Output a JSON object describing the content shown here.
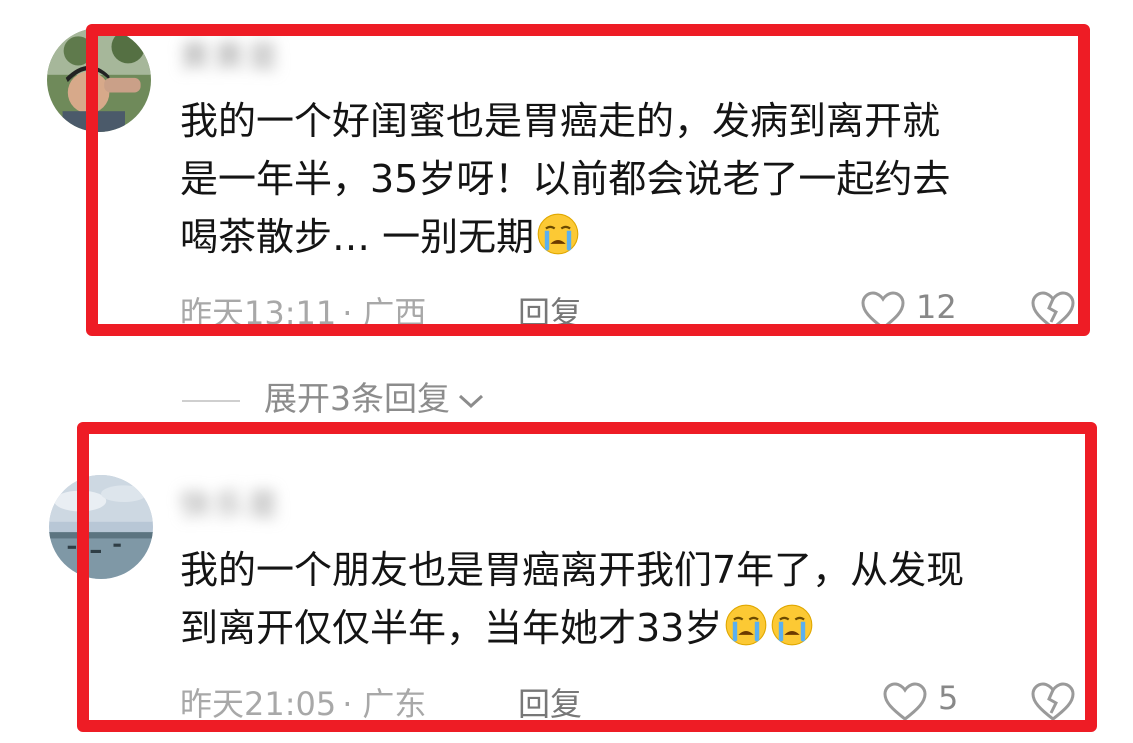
{
  "comments": [
    {
      "username": "黄黄是",
      "text_lines": [
        "我的一个好闺蜜也是胃癌走的，发病到离开就",
        "是一年半，35岁呀！以前都会说老了一起约去",
        "喝茶散步… 一别无期"
      ],
      "emoji_count": 1,
      "time": "昨天13:11",
      "location": "广西",
      "reply_label": "回复",
      "likes": "12",
      "avatar_icon": "person-saluting-avatar-icon"
    },
    {
      "username": "快乐是",
      "text_lines": [
        "我的一个朋友也是胃癌离开我们7年了，从发现",
        "到离开仅仅半年，当年她才33岁"
      ],
      "emoji_count": 2,
      "time": "昨天21:05",
      "location": "广东",
      "reply_label": "回复",
      "likes": "5",
      "avatar_icon": "sea-landscape-avatar-icon"
    }
  ],
  "expand_replies": {
    "label": "展开3条回复"
  },
  "colors": {
    "highlight_box": "#ee1c25",
    "meta_text": "#a8a8a8"
  },
  "icons": {
    "emoji": "crying-face-icon",
    "like": "heart-icon",
    "dislike": "broken-heart-icon",
    "expand": "chevron-down-icon"
  }
}
